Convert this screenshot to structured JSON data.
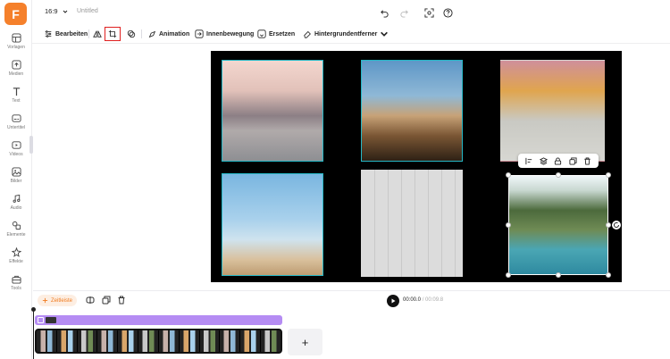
{
  "sidebar": {
    "logo": "F",
    "items": [
      {
        "label": "Vorlagen",
        "icon": "layout-icon"
      },
      {
        "label": "Medien",
        "icon": "upload-icon"
      },
      {
        "label": "Text",
        "icon": "text-icon"
      },
      {
        "label": "Untertitel",
        "icon": "subtitle-icon"
      },
      {
        "label": "Videos",
        "icon": "video-icon"
      },
      {
        "label": "Bilder",
        "icon": "image-icon"
      },
      {
        "label": "Audio",
        "icon": "music-icon"
      },
      {
        "label": "Elemente",
        "icon": "shapes-icon"
      },
      {
        "label": "Effekte",
        "icon": "effects-icon"
      },
      {
        "label": "Tools",
        "icon": "toolbox-icon"
      }
    ]
  },
  "topbar": {
    "ratio": "16:9",
    "title": "Untitled"
  },
  "toolbar": {
    "edit": "Bearbeiten",
    "animation": "Animation",
    "motion": "Innenbewegung",
    "replace": "Ersetzen",
    "bg_remover": "Hintergrundentferner"
  },
  "timeline": {
    "timeline_button": "Zeitleiste",
    "current_time": "00:00.0",
    "separator": " / ",
    "total_time": "00:09.8",
    "add_label": "+"
  },
  "colors": {
    "accent": "#f5802b",
    "selection": "#26b8c6",
    "track": "#b58cf3",
    "crop_highlight": "#e02020"
  }
}
